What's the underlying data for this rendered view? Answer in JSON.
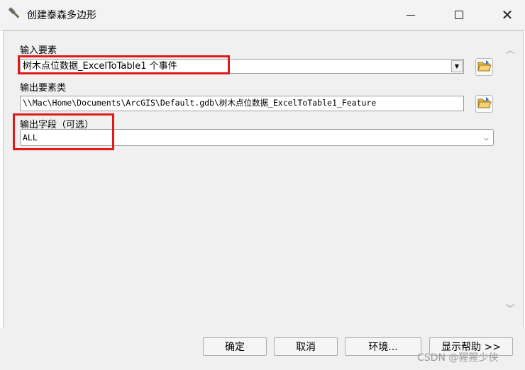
{
  "window": {
    "title": "创建泰森多边形",
    "close_glyph": "✕"
  },
  "fields": {
    "input_features": {
      "label": "输入要素",
      "value": "树木点位数据_ExcelToTable1 个事件"
    },
    "output_feature_class": {
      "label": "输出要素类",
      "value": "\\\\Mac\\Home\\Documents\\ArcGIS\\Default.gdb\\树木点位数据_ExcelToTable1_Feature"
    },
    "output_fields": {
      "label": "输出字段（可选）",
      "value": "ALL"
    }
  },
  "glyphs": {
    "dropdown_arrow": "▼",
    "chevron_down": "⌵",
    "scroll_up": "︿",
    "scroll_down": "﹀"
  },
  "buttons": {
    "ok": "确定",
    "cancel": "取消",
    "environments": "环境...",
    "show_help": "显示帮助 >>"
  },
  "watermark": "CSDN @猩猩少侠",
  "colors": {
    "highlight_red": "#e01a1a",
    "panel_bg": "#f0f0f0"
  },
  "icons": [
    "hammer-icon",
    "folder-open-icon",
    "minimize-icon",
    "maximize-icon",
    "close-icon"
  ]
}
